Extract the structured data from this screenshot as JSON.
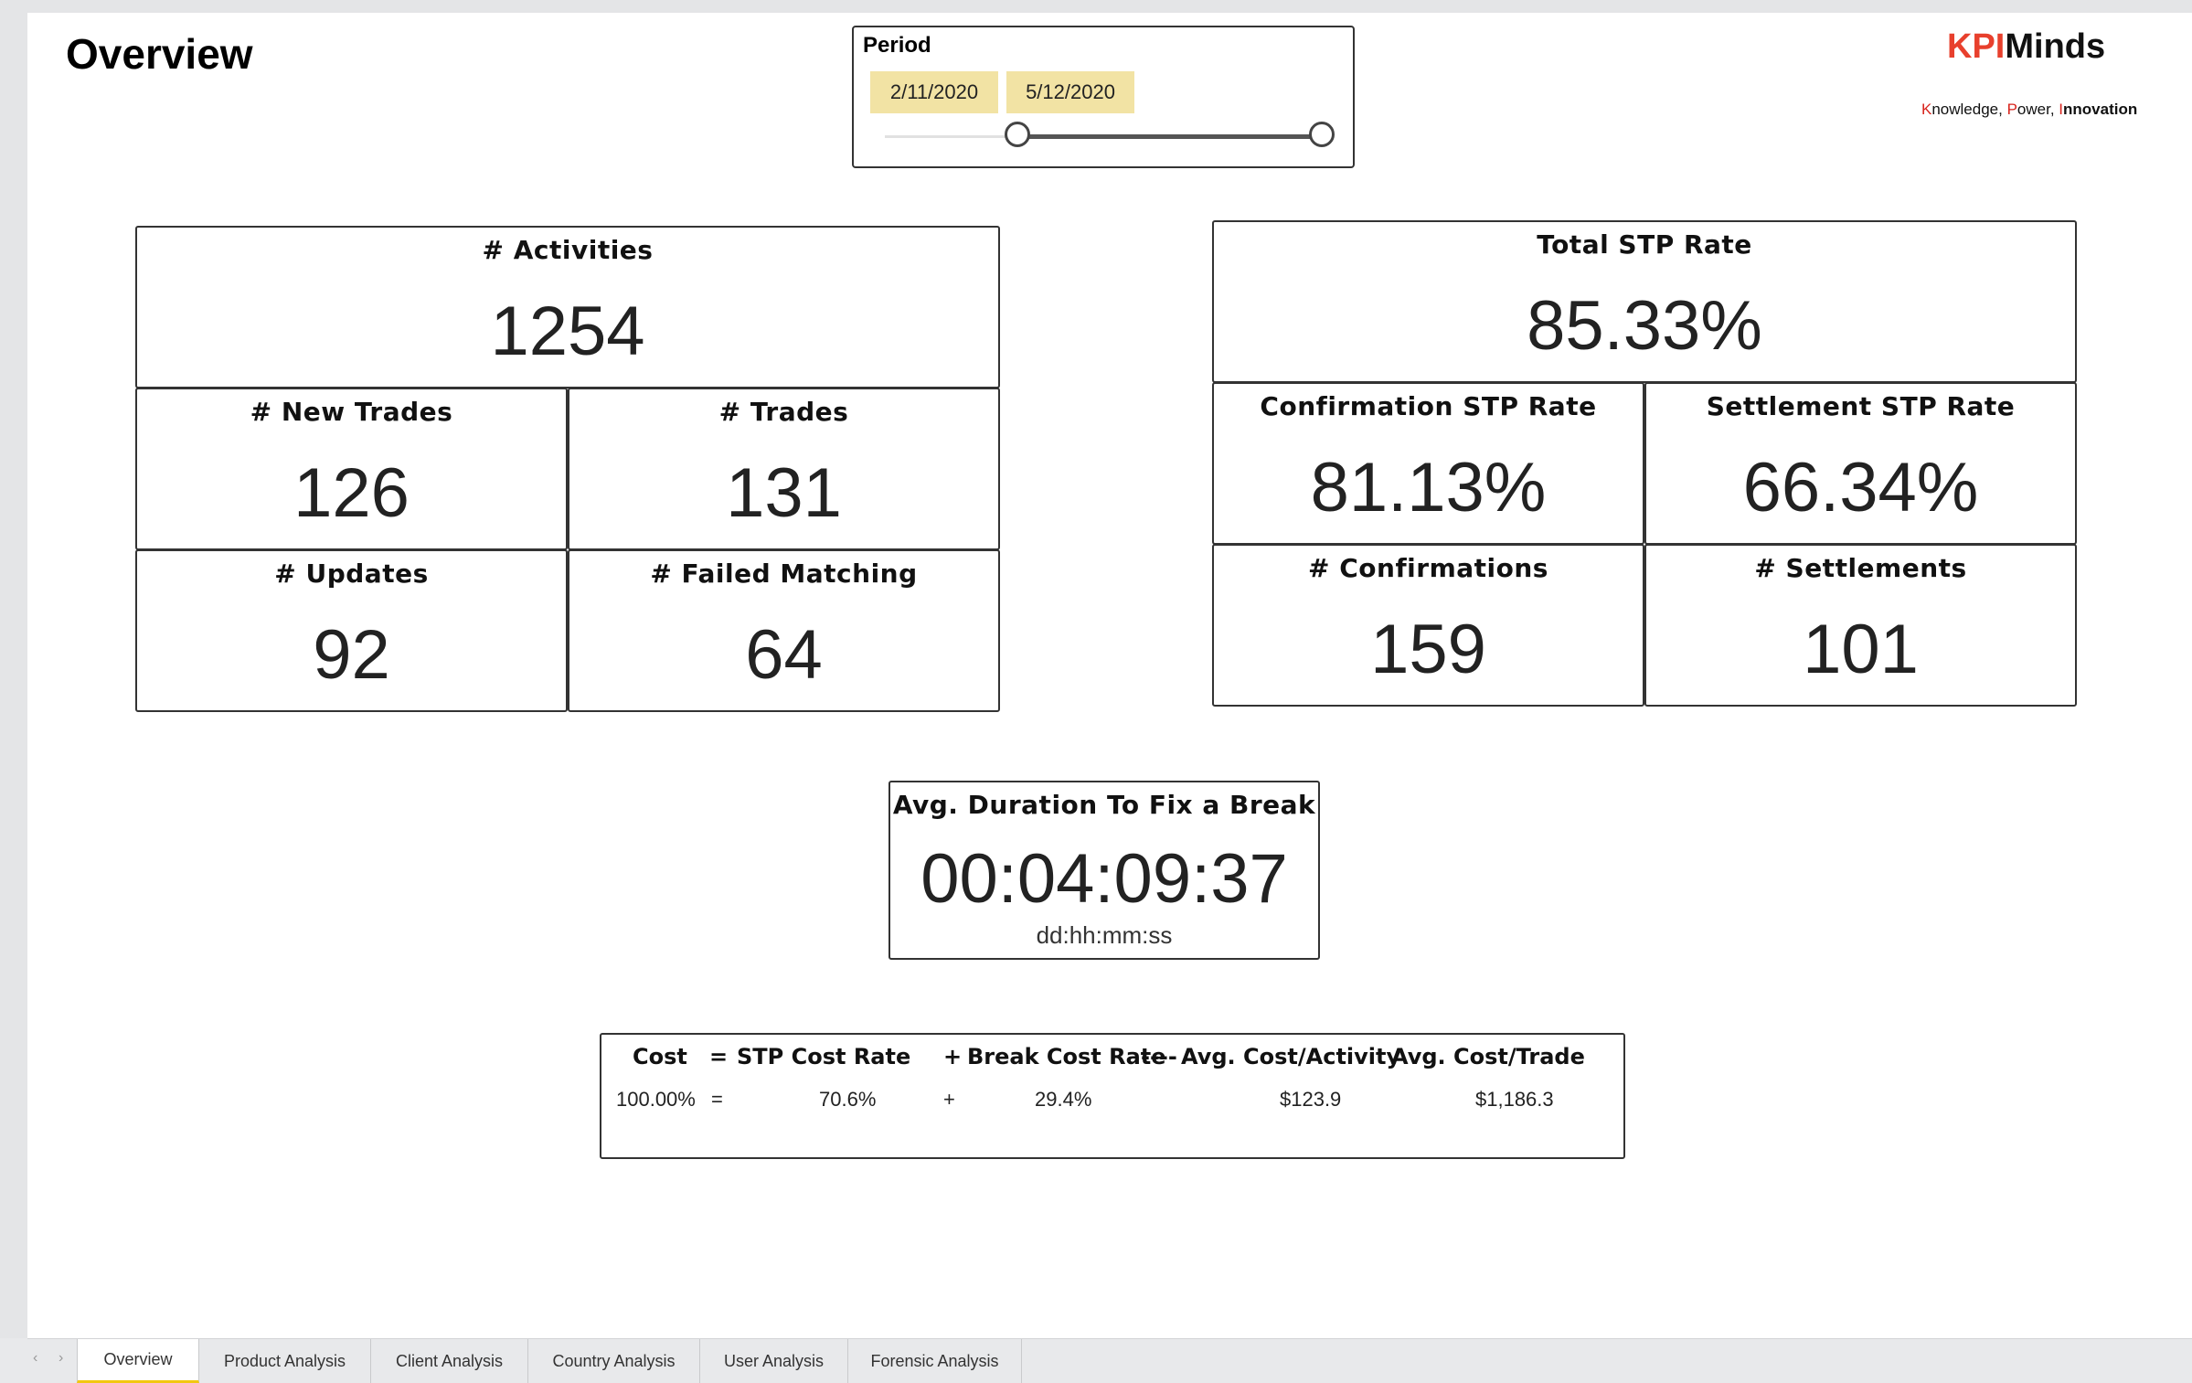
{
  "page": {
    "title": "Overview"
  },
  "period": {
    "label": "Period",
    "start": "2/11/2020",
    "end": "5/12/2020",
    "range": {
      "start_fraction": 0.3,
      "end_fraction": 1.0
    }
  },
  "brand": {
    "part1": "KPI",
    "part2": "Minds",
    "tagline": {
      "k": "K",
      "nowledge": "nowledge, ",
      "p": "P",
      "ower": "ower, ",
      "i": "I",
      "nnovation": "nnovation"
    }
  },
  "kpis": {
    "activities": {
      "title": "# Activities",
      "value": "1254"
    },
    "new_trades": {
      "title": "# New Trades",
      "value": "126"
    },
    "trades": {
      "title": "# Trades",
      "value": "131"
    },
    "updates": {
      "title": "# Updates",
      "value": "92"
    },
    "failed_matching": {
      "title": "# Failed Matching",
      "value": "64"
    },
    "total_stp": {
      "title": "Total STP Rate",
      "value": "85.33%"
    },
    "confirmation_stp": {
      "title": "Confirmation STP Rate",
      "value": "81.13%"
    },
    "settlement_stp": {
      "title": "Settlement STP Rate",
      "value": "66.34%"
    },
    "confirmations": {
      "title": "# Confirmations",
      "value": "159"
    },
    "settlements": {
      "title": "# Settlements",
      "value": "101"
    },
    "avg_duration": {
      "title": "Avg. Duration To Fix a Break",
      "value": "00:04:09:37",
      "unit": "dd:hh:mm:ss"
    }
  },
  "cost": {
    "headers": {
      "cost": "Cost",
      "eq": "=",
      "stp": "STP Cost Rate",
      "plus": "+",
      "brk": "Break Cost Rate",
      "sep": "----",
      "avg_activity": "Avg. Cost/Activity",
      "avg_trade": "Avg. Cost/Trade"
    },
    "values": {
      "cost": "100.00%",
      "eq": "=",
      "stp": "70.6%",
      "plus": "+",
      "brk": "29.4%",
      "avg_activity": "$123.9",
      "avg_trade": "$1,186.3"
    }
  },
  "tabs": {
    "prev": "‹",
    "next": "›",
    "items": [
      "Overview",
      "Product Analysis",
      "Client Analysis",
      "Country Analysis",
      "User Analysis",
      "Forensic Analysis"
    ]
  }
}
